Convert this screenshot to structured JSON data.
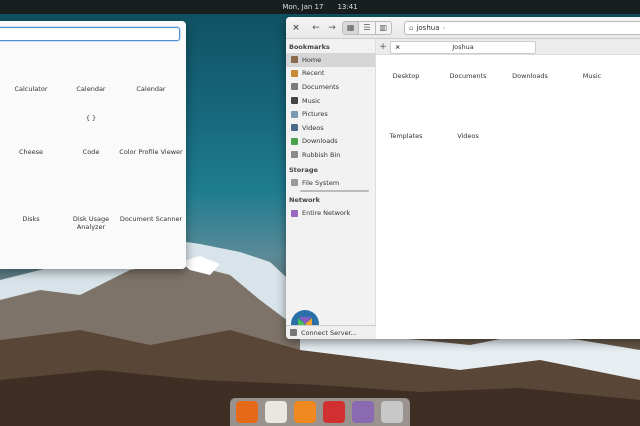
{
  "top_panel": {
    "date": "Mon, Jan 17",
    "time": "13:41"
  },
  "app_menu": {
    "search_placeholder": "",
    "apps": [
      {
        "label": "Calculator",
        "icon": "calculator-icon"
      },
      {
        "label": "Calendar",
        "icon": "calendar-icon"
      },
      {
        "label": "Calendar",
        "icon": "calendar-icon"
      },
      {
        "label": "Cheese",
        "icon": "cheese-icon"
      },
      {
        "label": "Code",
        "icon": "code-icon"
      },
      {
        "label": "Color Profile Viewer",
        "icon": "color-profile-icon"
      },
      {
        "label": "Disks",
        "icon": "disks-icon"
      },
      {
        "label": "Disk Usage Analyzer",
        "icon": "disk-usage-icon"
      },
      {
        "label": "Document Scanner",
        "icon": "scanner-icon"
      }
    ],
    "page_count": 3,
    "active_page": 1
  },
  "file_manager": {
    "path_segment": "joshua",
    "tab_label": "Joshua",
    "sidebar": {
      "bookmarks_heading": "Bookmarks",
      "bookmarks": [
        {
          "label": "Home",
          "icon": "home-icon",
          "color": "#8a6a4a"
        },
        {
          "label": "Recent",
          "icon": "recent-icon",
          "color": "#c88a30"
        },
        {
          "label": "Documents",
          "icon": "documents-icon",
          "color": "#7a7a7a"
        },
        {
          "label": "Music",
          "icon": "music-icon",
          "color": "#444444"
        },
        {
          "label": "Pictures",
          "icon": "pictures-icon",
          "color": "#7a9ab0"
        },
        {
          "label": "Videos",
          "icon": "videos-icon",
          "color": "#4a6a8a"
        },
        {
          "label": "Downloads",
          "icon": "downloads-icon",
          "color": "#4aa04a"
        },
        {
          "label": "Rubbish Bin",
          "icon": "trash-icon",
          "color": "#8a8a8a"
        }
      ],
      "storage_heading": "Storage",
      "storage": [
        {
          "label": "File System",
          "icon": "drive-icon",
          "color": "#999999"
        }
      ],
      "network_heading": "Network",
      "network": [
        {
          "label": "Entire Network",
          "icon": "network-icon",
          "color": "#9a6ac0"
        }
      ],
      "connect_label": "Connect Server..."
    },
    "folders": [
      {
        "label": "Desktop",
        "emblem": ""
      },
      {
        "label": "Documents",
        "emblem": "document"
      },
      {
        "label": "Downloads",
        "emblem": "download"
      },
      {
        "label": "Music",
        "emblem": "music"
      },
      {
        "label": "Templates",
        "emblem": "template"
      },
      {
        "label": "Videos",
        "emblem": "video"
      }
    ]
  },
  "dock": {
    "items": [
      {
        "name": "firefox-icon",
        "color": "#e66a1a"
      },
      {
        "name": "calendar-icon",
        "color": "#e8e8e0"
      },
      {
        "name": "music-icon",
        "color": "#f08a20"
      },
      {
        "name": "videos-icon",
        "color": "#d03030"
      },
      {
        "name": "photos-icon",
        "color": "#8a6ab0"
      },
      {
        "name": "app-center-icon",
        "color": "#c8c8c8"
      }
    ]
  },
  "colors": {
    "accent": "#4a90d9",
    "folder": "#e9d3a8",
    "folder_dark": "#d8b98a"
  }
}
